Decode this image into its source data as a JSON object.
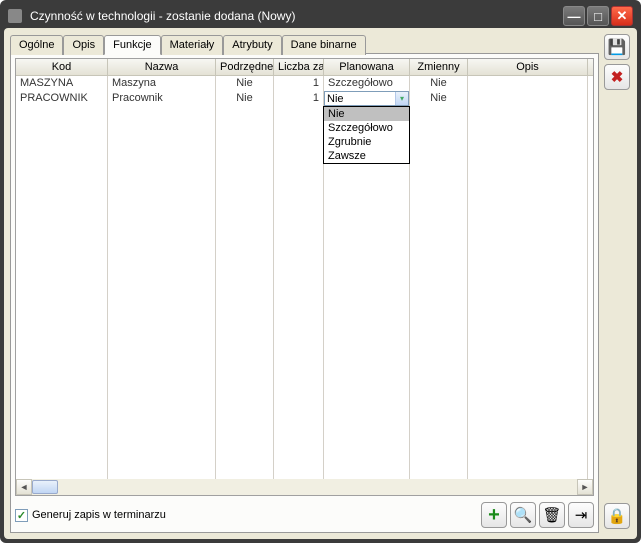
{
  "window": {
    "title": "Czynność w technologii - zostanie dodana  (Nowy)"
  },
  "tabs": [
    {
      "label": "Ogólne"
    },
    {
      "label": "Opis"
    },
    {
      "label": "Funkcje"
    },
    {
      "label": "Materiały"
    },
    {
      "label": "Atrybuty"
    },
    {
      "label": "Dane binarne"
    }
  ],
  "active_tab": 2,
  "grid": {
    "columns": [
      {
        "label": "Kod"
      },
      {
        "label": "Nazwa"
      },
      {
        "label": "Podrzędne"
      },
      {
        "label": "Liczba zas"
      },
      {
        "label": "Planowana"
      },
      {
        "label": "Zmienny"
      },
      {
        "label": "Opis"
      }
    ],
    "rows": [
      {
        "kod": "MASZYNA",
        "nazwa": "Maszyna",
        "podrzedne": "Nie",
        "liczba": "1",
        "planowana": "Szczegółowo",
        "zmienny": "Nie",
        "opis": ""
      },
      {
        "kod": "PRACOWNIK",
        "nazwa": "Pracownik",
        "podrzedne": "Nie",
        "liczba": "1",
        "planowana": "Nie",
        "zmienny": "Nie",
        "opis": ""
      }
    ]
  },
  "dropdown": {
    "selected": "Nie",
    "options": [
      "Nie",
      "Szczegółowo",
      "Zgrubnie",
      "Zawsze"
    ]
  },
  "checkbox": {
    "label": "Generuj zapis w terminarzu",
    "checked": true
  },
  "icons": {
    "save": "💾",
    "cancel": "✖",
    "lock": "🔒",
    "add": "+",
    "search": "🔍",
    "trash": "🗑",
    "insert": "⇥"
  }
}
